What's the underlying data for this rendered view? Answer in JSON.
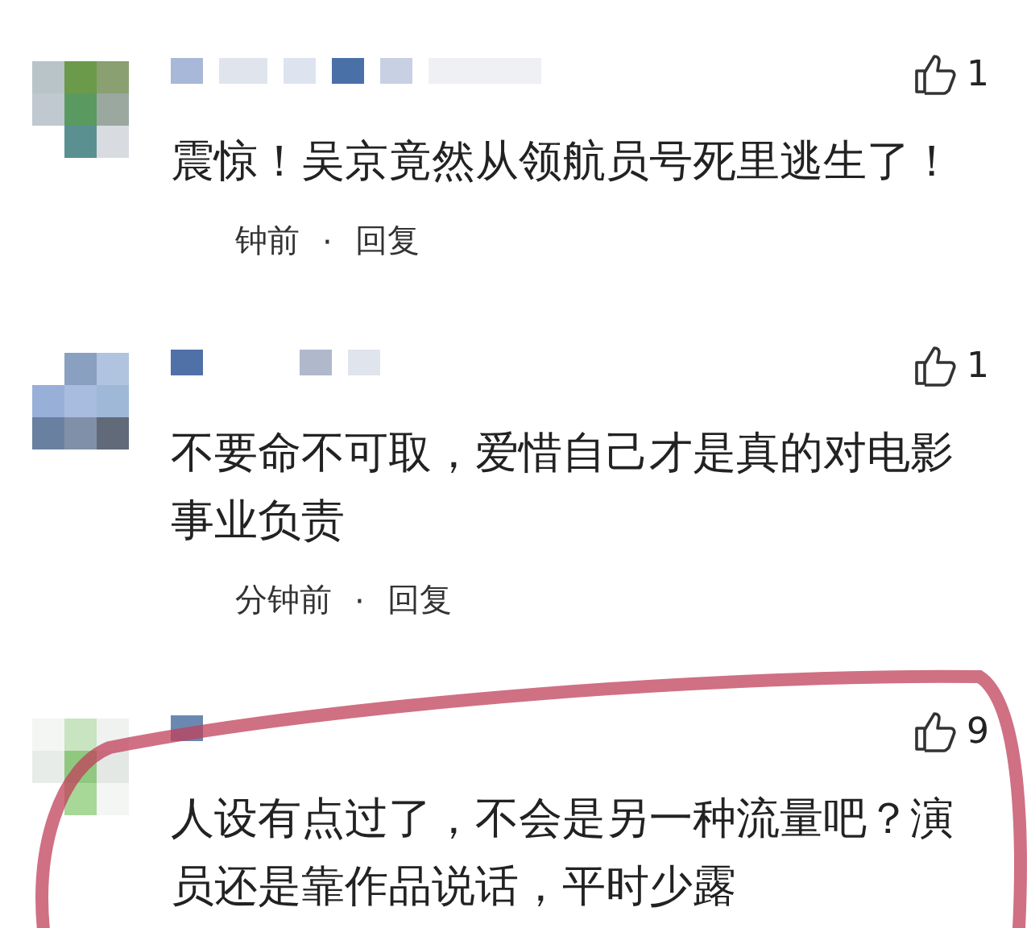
{
  "comments": [
    {
      "likes": "1",
      "text": "震惊！吴京竟然从领航员号死里逃生了！",
      "meta": {
        "time": "钟前",
        "separator": "·",
        "reply": "回复"
      },
      "circled": false
    },
    {
      "likes": "1",
      "text": "不要命不可取，爱惜自己才是真的对电影事业负责",
      "meta": {
        "time": "分钟前",
        "separator": "·",
        "reply": "回复"
      },
      "circled": false
    },
    {
      "likes": "9",
      "text": "人设有点过了，不会是另一种流量吧？演员还是靠作品说话，平时少露",
      "circled": true
    }
  ]
}
